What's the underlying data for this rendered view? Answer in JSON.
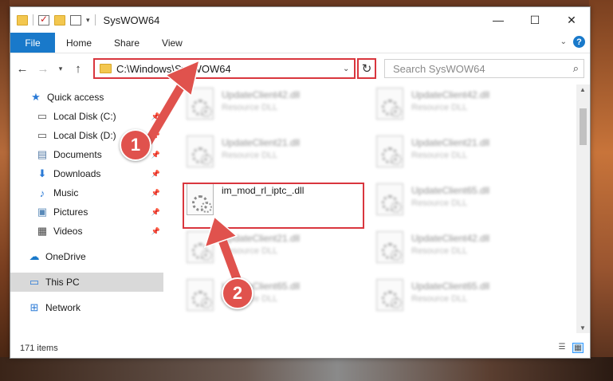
{
  "window": {
    "title": "SysWOW64",
    "controls": {
      "minimize": "—",
      "maximize": "☐",
      "close": "✕"
    }
  },
  "ribbon": {
    "tabs": [
      {
        "label": "File",
        "active": true
      },
      {
        "label": "Home"
      },
      {
        "label": "Share"
      },
      {
        "label": "View"
      }
    ],
    "help": "?"
  },
  "address": {
    "path": "C:\\Windows\\SysWOW64",
    "search_placeholder": "Search SysWOW64"
  },
  "nav": {
    "items": [
      {
        "label": "Quick access",
        "icon": "star-icon",
        "pinned": false
      },
      {
        "label": "Local Disk (C:)",
        "icon": "drive-icon",
        "pinned": true
      },
      {
        "label": "Local Disk (D:)",
        "icon": "drive-icon",
        "pinned": true
      },
      {
        "label": "Documents",
        "icon": "documents-icon",
        "pinned": true
      },
      {
        "label": "Downloads",
        "icon": "downloads-icon",
        "pinned": true
      },
      {
        "label": "Music",
        "icon": "music-icon",
        "pinned": true
      },
      {
        "label": "Pictures",
        "icon": "pictures-icon",
        "pinned": true
      },
      {
        "label": "Videos",
        "icon": "videos-icon",
        "pinned": true
      },
      {
        "label": "OneDrive",
        "icon": "onedrive-icon"
      },
      {
        "label": "This PC",
        "icon": "this-pc-icon",
        "selected": true
      },
      {
        "label": "Network",
        "icon": "network-icon"
      }
    ]
  },
  "files": [
    {
      "name": "UpdateClient42.dll",
      "type": "Resource DLL",
      "blurred": true
    },
    {
      "name": "UpdateClient42.dll",
      "type": "Resource DLL",
      "blurred": true
    },
    {
      "name": "UpdateClient21.dll",
      "type": "Resource DLL",
      "blurred": true
    },
    {
      "name": "UpdateClient21.dll",
      "type": "Resource DLL",
      "blurred": true
    },
    {
      "name": "im_mod_rl_iptc_.dll",
      "type": "",
      "blurred": false,
      "highlighted": true
    },
    {
      "name": "UpdateClient65.dll",
      "type": "Resource DLL",
      "blurred": true
    },
    {
      "name": "UpdateClient21.dll",
      "type": "Resource DLL",
      "blurred": true
    },
    {
      "name": "UpdateClient42.dll",
      "type": "Resource DLL",
      "blurred": true
    },
    {
      "name": "UpdateClient65.dll",
      "type": "Resource DLL",
      "blurred": true
    },
    {
      "name": "UpdateClient65.dll",
      "type": "Resource DLL",
      "blurred": true
    }
  ],
  "status": {
    "item_count": "171 items"
  },
  "callouts": {
    "one": "1",
    "two": "2",
    "color": "#e0524d"
  },
  "colors": {
    "accent": "#1979ca",
    "highlight_border": "#d9363e"
  }
}
